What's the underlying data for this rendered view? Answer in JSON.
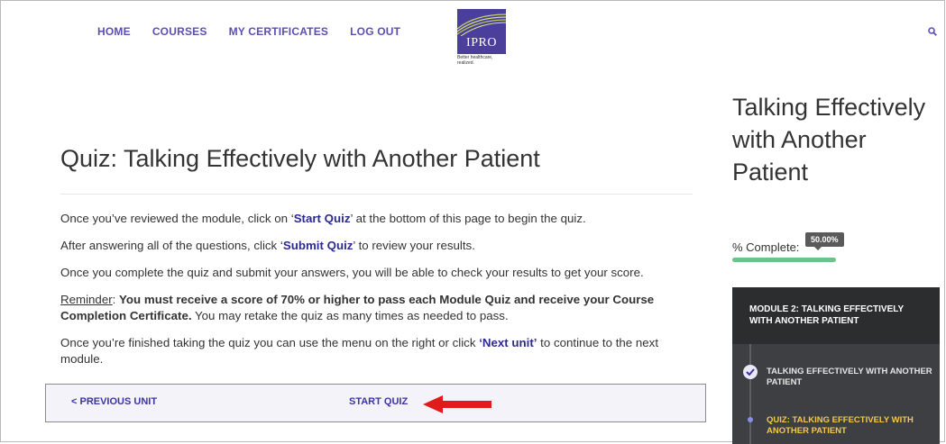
{
  "nav": {
    "items": [
      "HOME",
      "COURSES",
      "MY CERTIFICATES",
      "LOG OUT"
    ]
  },
  "logo": {
    "text": "IPRO",
    "tagline_line1": "Better healthcare,",
    "tagline_line2": "realized."
  },
  "main": {
    "title": "Quiz: Talking Effectively with Another Patient",
    "p1_pre": "Once you’ve reviewed the module, click on ‘",
    "p1_link": "Start Quiz",
    "p1_post": "’ at the bottom of this page to begin the quiz.",
    "p2_pre": "After answering all of the questions, click ‘",
    "p2_link": "Submit Quiz",
    "p2_post": "’ to review your results.",
    "p3": "Once you complete the quiz and submit your answers, you will be able to check your results to get your score.",
    "p4_label": "Reminder",
    "p4_colon": ": ",
    "p4_bold": "You must receive a score of 70% or higher to pass each Module Quiz and receive your Course Completion Certificate.",
    "p4_post": " You may retake the quiz as many times as needed to pass.",
    "p5_pre": "Once you’re finished taking the quiz you can use the menu on the right or click ",
    "p5_link": "‘Next unit’",
    "p5_post": " to continue to the next module."
  },
  "unit_bar": {
    "prev": "< PREVIOUS UNIT",
    "start": "START QUIZ"
  },
  "sidebar": {
    "title": "Talking Effectively with Another Patient",
    "pct_label": "% Complete:",
    "pct_value": "50.00%",
    "progress": 0.5,
    "module_heading": "MODULE 2: TALKING EFFECTIVELY WITH ANOTHER PATIENT",
    "lessons": [
      {
        "label": "TALKING EFFECTIVELY WITH ANOTHER PATIENT",
        "status": "complete"
      },
      {
        "label": "QUIZ: TALKING EFFECTIVELY WITH ANOTHER PATIENT",
        "status": "current"
      }
    ]
  },
  "colors": {
    "accent": "#5b4fb3",
    "progress": "#6fc28a",
    "current_lesson": "#f3c94a",
    "arrow": "#e01b1b"
  }
}
